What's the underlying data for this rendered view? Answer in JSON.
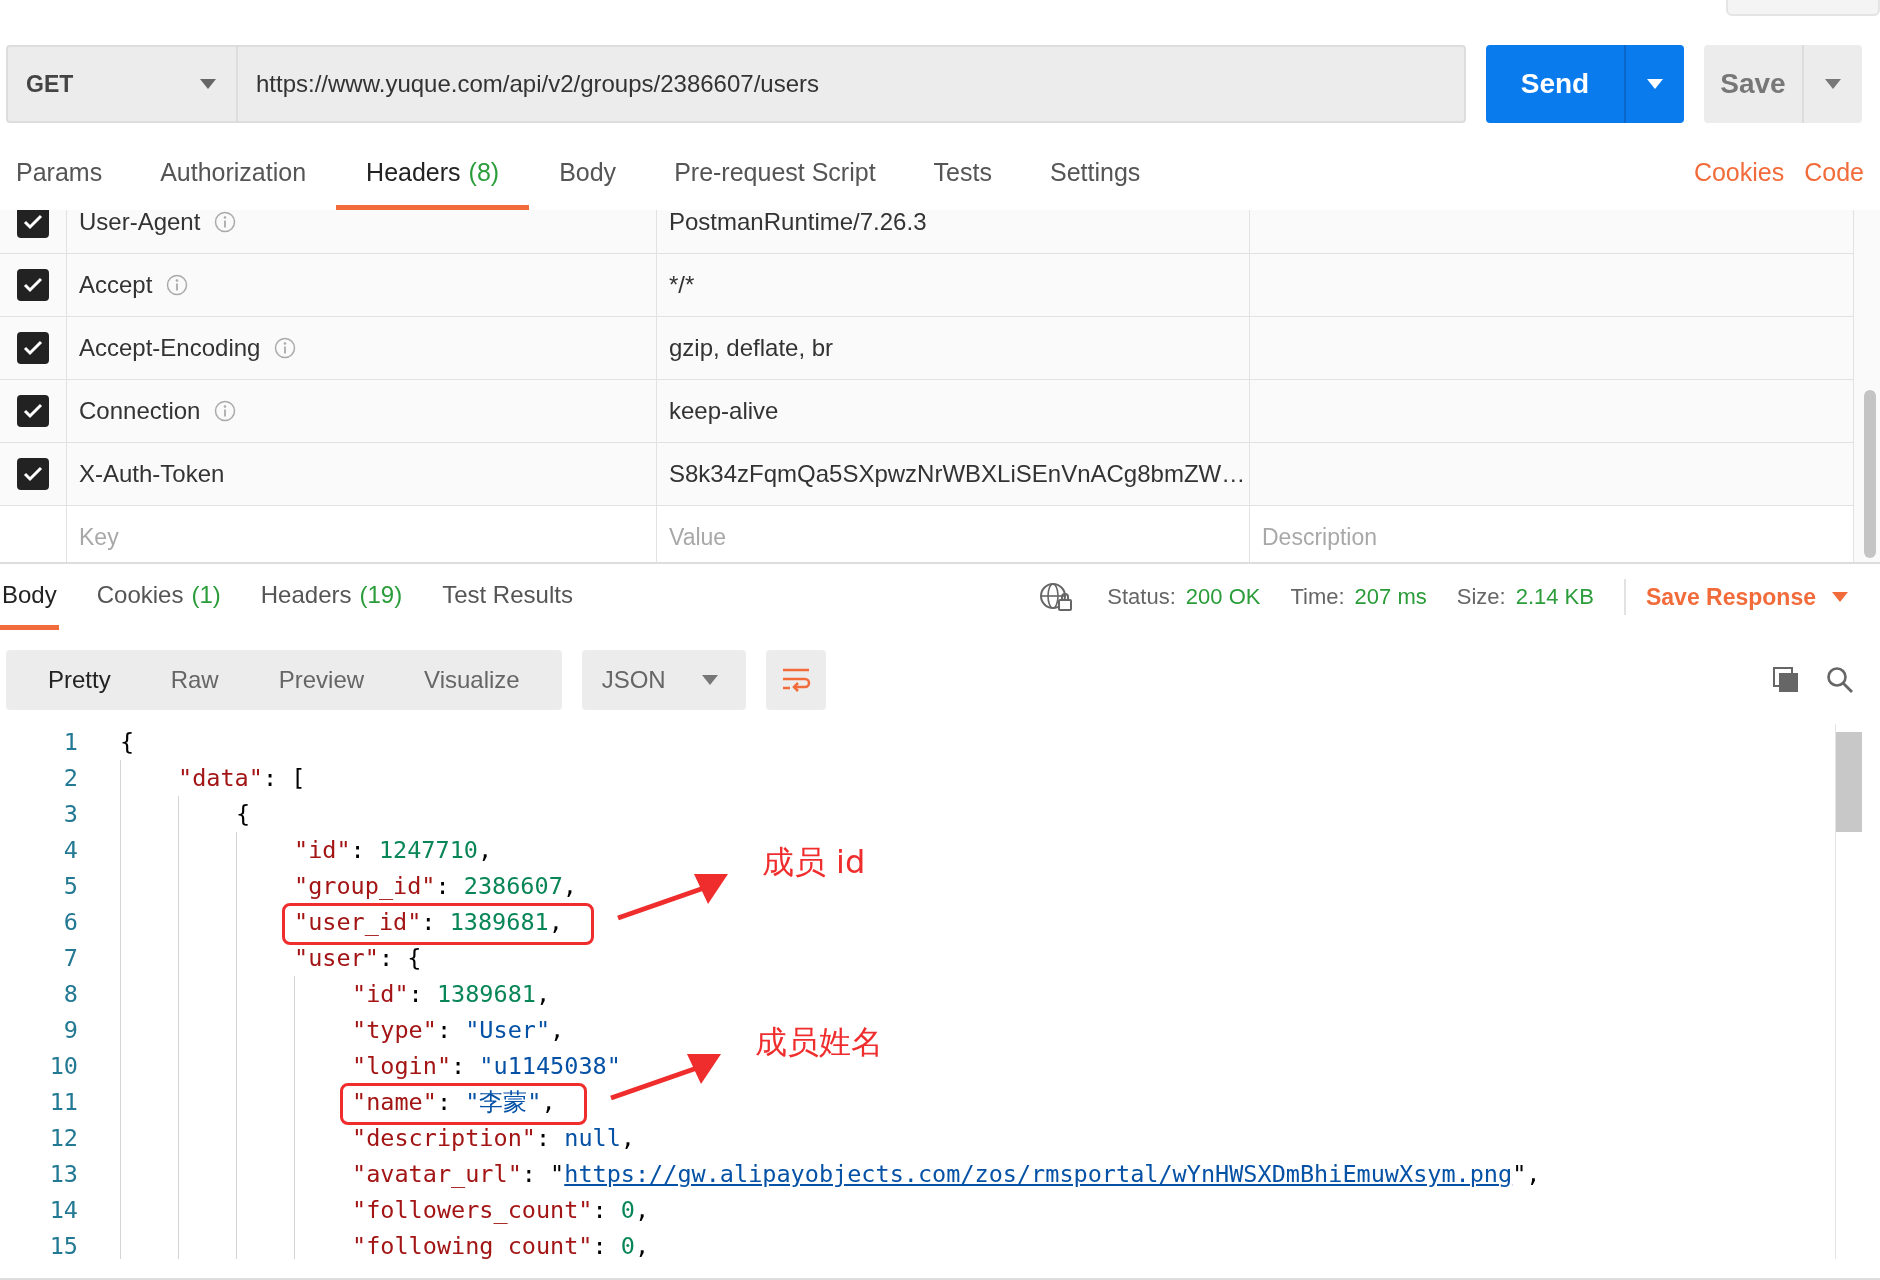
{
  "request": {
    "method": "GET",
    "url": "https://www.yuque.com/api/v2/groups/2386607/users",
    "send_label": "Send",
    "save_label": "Save"
  },
  "request_tabs": [
    {
      "label": "Params",
      "selected": false
    },
    {
      "label": "Authorization",
      "selected": false
    },
    {
      "label": "Headers",
      "count": "(8)",
      "selected": true
    },
    {
      "label": "Body",
      "selected": false
    },
    {
      "label": "Pre-request Script",
      "selected": false
    },
    {
      "label": "Tests",
      "selected": false
    },
    {
      "label": "Settings",
      "selected": false
    }
  ],
  "request_links": [
    "Cookies",
    "Code"
  ],
  "headers_table": {
    "rows": [
      {
        "key": "User-Agent",
        "value": "PostmanRuntime/7.26.3",
        "checked": true,
        "info": true
      },
      {
        "key": "Accept",
        "value": "*/*",
        "checked": true,
        "info": true
      },
      {
        "key": "Accept-Encoding",
        "value": "gzip, deflate, br",
        "checked": true,
        "info": true
      },
      {
        "key": "Connection",
        "value": "keep-alive",
        "checked": true,
        "info": true
      },
      {
        "key": "X-Auth-Token",
        "value": "S8k34zFqmQa5SXpwzNrWBXLiSEnVnACg8bmZW…",
        "checked": true,
        "info": false
      }
    ],
    "new_row": {
      "key_field": {
        "placeholder": "Key"
      },
      "value_field": {
        "placeholder": "Value"
      },
      "description_field": {
        "placeholder": "Description"
      }
    }
  },
  "response_tabs": [
    {
      "label": "Body",
      "selected": true
    },
    {
      "label": "Cookies",
      "count": "(1)",
      "selected": false
    },
    {
      "label": "Headers",
      "count": "(19)",
      "selected": false
    },
    {
      "label": "Test Results",
      "selected": false
    }
  ],
  "status": {
    "status_label": "Status:",
    "status_value": "200 OK",
    "time_label": "Time:",
    "time_value": "207 ms",
    "size_label": "Size:",
    "size_value": "2.14 KB",
    "save_response": "Save Response"
  },
  "view_modes": [
    {
      "label": "Pretty",
      "selected": true
    },
    {
      "label": "Raw",
      "selected": false
    },
    {
      "label": "Preview",
      "selected": false
    },
    {
      "label": "Visualize",
      "selected": false
    }
  ],
  "format": "JSON",
  "code_lines": [
    {
      "number": "1",
      "highlighted": false,
      "tokens": [
        {
          "kind": "punct",
          "text": "{"
        }
      ],
      "children": [
        {
          "number": "2",
          "highlighted": false,
          "tokens": [
            {
              "kind": "key",
              "text": "\"data\""
            },
            {
              "kind": "punct",
              "text": ": ["
            }
          ],
          "children": [
            {
              "number": "3",
              "highlighted": false,
              "tokens": [
                {
                  "kind": "punct",
                  "text": "{"
                }
              ],
              "children": [
                {
                  "number": "4",
                  "highlighted": false,
                  "tokens": [
                    {
                      "kind": "key",
                      "text": "\"id\""
                    },
                    {
                      "kind": "punct",
                      "text": ": "
                    },
                    {
                      "kind": "number",
                      "text": "1247710"
                    },
                    {
                      "kind": "punct",
                      "text": ","
                    }
                  ]
                },
                {
                  "number": "5",
                  "highlighted": false,
                  "tokens": [
                    {
                      "kind": "key",
                      "text": "\"group_id\""
                    },
                    {
                      "kind": "punct",
                      "text": ": "
                    },
                    {
                      "kind": "number",
                      "text": "2386607"
                    },
                    {
                      "kind": "punct",
                      "text": ","
                    }
                  ]
                },
                {
                  "number": "6",
                  "highlighted": true,
                  "annotation": "成员 id",
                  "tokens": [
                    {
                      "kind": "key",
                      "text": "\"user_id\""
                    },
                    {
                      "kind": "punct",
                      "text": ": "
                    },
                    {
                      "kind": "number",
                      "text": "1389681"
                    },
                    {
                      "kind": "punct",
                      "text": ","
                    }
                  ]
                },
                {
                  "number": "7",
                  "highlighted": false,
                  "tokens": [
                    {
                      "kind": "key",
                      "text": "\"user\""
                    },
                    {
                      "kind": "punct",
                      "text": ": {"
                    }
                  ],
                  "children": [
                    {
                      "number": "8",
                      "highlighted": false,
                      "tokens": [
                        {
                          "kind": "key",
                          "text": "\"id\""
                        },
                        {
                          "kind": "punct",
                          "text": ": "
                        },
                        {
                          "kind": "number",
                          "text": "1389681"
                        },
                        {
                          "kind": "punct",
                          "text": ","
                        }
                      ]
                    },
                    {
                      "number": "9",
                      "highlighted": false,
                      "tokens": [
                        {
                          "kind": "key",
                          "text": "\"type\""
                        },
                        {
                          "kind": "punct",
                          "text": ": "
                        },
                        {
                          "kind": "string",
                          "text": "\"User\""
                        },
                        {
                          "kind": "punct",
                          "text": ","
                        }
                      ]
                    },
                    {
                      "number": "10",
                      "highlighted": false,
                      "tokens": [
                        {
                          "kind": "key",
                          "text": "\"login\""
                        },
                        {
                          "kind": "punct",
                          "text": ": "
                        },
                        {
                          "kind": "string",
                          "text": "\"u1145038\""
                        }
                      ]
                    },
                    {
                      "number": "11",
                      "highlighted": true,
                      "annotation": "成员姓名",
                      "tokens": [
                        {
                          "kind": "key",
                          "text": "\"name\""
                        },
                        {
                          "kind": "punct",
                          "text": ": "
                        },
                        {
                          "kind": "string",
                          "text": "\"李蒙\""
                        },
                        {
                          "kind": "punct",
                          "text": ","
                        }
                      ]
                    },
                    {
                      "number": "12",
                      "highlighted": false,
                      "tokens": [
                        {
                          "kind": "key",
                          "text": "\"description\""
                        },
                        {
                          "kind": "punct",
                          "text": ": "
                        },
                        {
                          "kind": "string",
                          "text": "null"
                        },
                        {
                          "kind": "punct",
                          "text": ","
                        }
                      ]
                    },
                    {
                      "number": "13",
                      "highlighted": false,
                      "tokens": [
                        {
                          "kind": "key",
                          "text": "\"avatar_url\""
                        },
                        {
                          "kind": "punct",
                          "text": ": \""
                        },
                        {
                          "kind": "link",
                          "text": "https://gw.alipayobjects.com/zos/rmsportal/wYnHWSXDmBhiEmuwXsym.png"
                        },
                        {
                          "kind": "punct",
                          "text": "\","
                        }
                      ]
                    },
                    {
                      "number": "14",
                      "highlighted": false,
                      "tokens": [
                        {
                          "kind": "key",
                          "text": "\"followers_count\""
                        },
                        {
                          "kind": "punct",
                          "text": ": "
                        },
                        {
                          "kind": "number",
                          "text": "0"
                        },
                        {
                          "kind": "punct",
                          "text": ","
                        }
                      ]
                    },
                    {
                      "number": "15",
                      "highlighted": false,
                      "tokens": [
                        {
                          "kind": "key",
                          "text": "\"following_count\""
                        },
                        {
                          "kind": "punct",
                          "text": ": "
                        },
                        {
                          "kind": "number",
                          "text": "0"
                        },
                        {
                          "kind": "punct",
                          "text": ","
                        }
                      ]
                    }
                  ]
                }
              ]
            }
          ]
        }
      ]
    }
  ]
}
